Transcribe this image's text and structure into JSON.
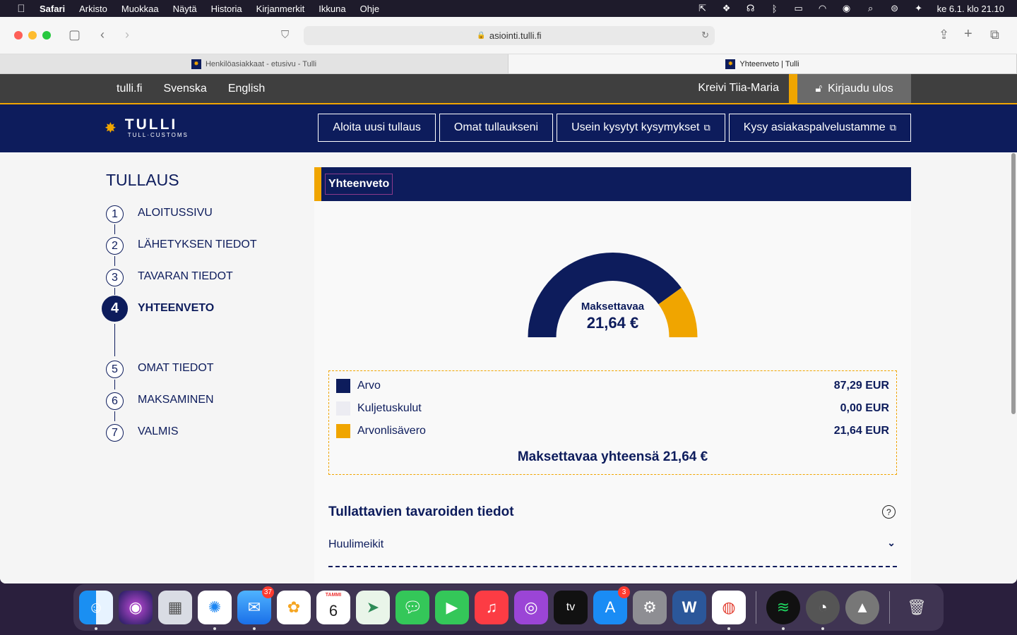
{
  "menubar": {
    "app": "Safari",
    "items": [
      "Arkisto",
      "Muokkaa",
      "Näytä",
      "Historia",
      "Kirjanmerkit",
      "Ikkuna",
      "Ohje"
    ],
    "clock": "ke 6.1. klo 21.10"
  },
  "browser": {
    "url": "asiointi.tulli.fi",
    "tabs": [
      {
        "title": "Henkilöasiakkaat - etusivu - Tulli"
      },
      {
        "title": "Yhteenveto | Tulli"
      }
    ]
  },
  "site": {
    "lang_links": [
      "tulli.fi",
      "Svenska",
      "English"
    ],
    "user_name": "Kreivi Tiia-Maria",
    "logout_label": "Kirjaudu ulos",
    "logo_word": "TULLI",
    "logo_sub": "TULL·CUSTOMS",
    "nav": [
      {
        "label": "Aloita uusi tullaus",
        "external": false
      },
      {
        "label": "Omat tullaukseni",
        "external": false
      },
      {
        "label": "Usein kysytyt kysymykset",
        "external": true
      },
      {
        "label": "Kysy asiakaspalvelustamme",
        "external": true
      }
    ]
  },
  "stepper": {
    "title": "TULLAUS",
    "steps": [
      {
        "num": "1",
        "label": "ALOITUSSIVU"
      },
      {
        "num": "2",
        "label": "LÄHETYKSEN TIEDOT"
      },
      {
        "num": "3",
        "label": "TAVARAN TIEDOT"
      },
      {
        "num": "4",
        "label": "YHTEENVETO",
        "active": true
      },
      {
        "num": "5",
        "label": "OMAT TIEDOT"
      },
      {
        "num": "6",
        "label": "MAKSAMINEN"
      },
      {
        "num": "7",
        "label": "VALMIS"
      }
    ]
  },
  "summary": {
    "header": "Yhteenveto",
    "gauge_label": "Maksettavaa",
    "gauge_amount": "21,64 €",
    "legend": [
      {
        "label": "Arvo",
        "value": "87,29 EUR",
        "color": "#0d1c5c",
        "amount": 87.29
      },
      {
        "label": "Kuljetuskulut",
        "value": "0,00 EUR",
        "color": "#ececf2",
        "amount": 0
      },
      {
        "label": "Arvonlisävero",
        "value": "21,64 EUR",
        "color": "#f0a500",
        "amount": 21.64
      }
    ],
    "total": "Maksettavaa yhteensä 21,64 €",
    "goods_title": "Tullattavien tavaroiden tiedot",
    "goods_item": "Huulimeikit"
  },
  "colors": {
    "navy": "#0d1c5c",
    "accent": "#f0a500"
  },
  "dock": {
    "mail_badge": "37",
    "appstore_badge": "3",
    "calendar_month": "TAMMI",
    "calendar_day": "6"
  }
}
